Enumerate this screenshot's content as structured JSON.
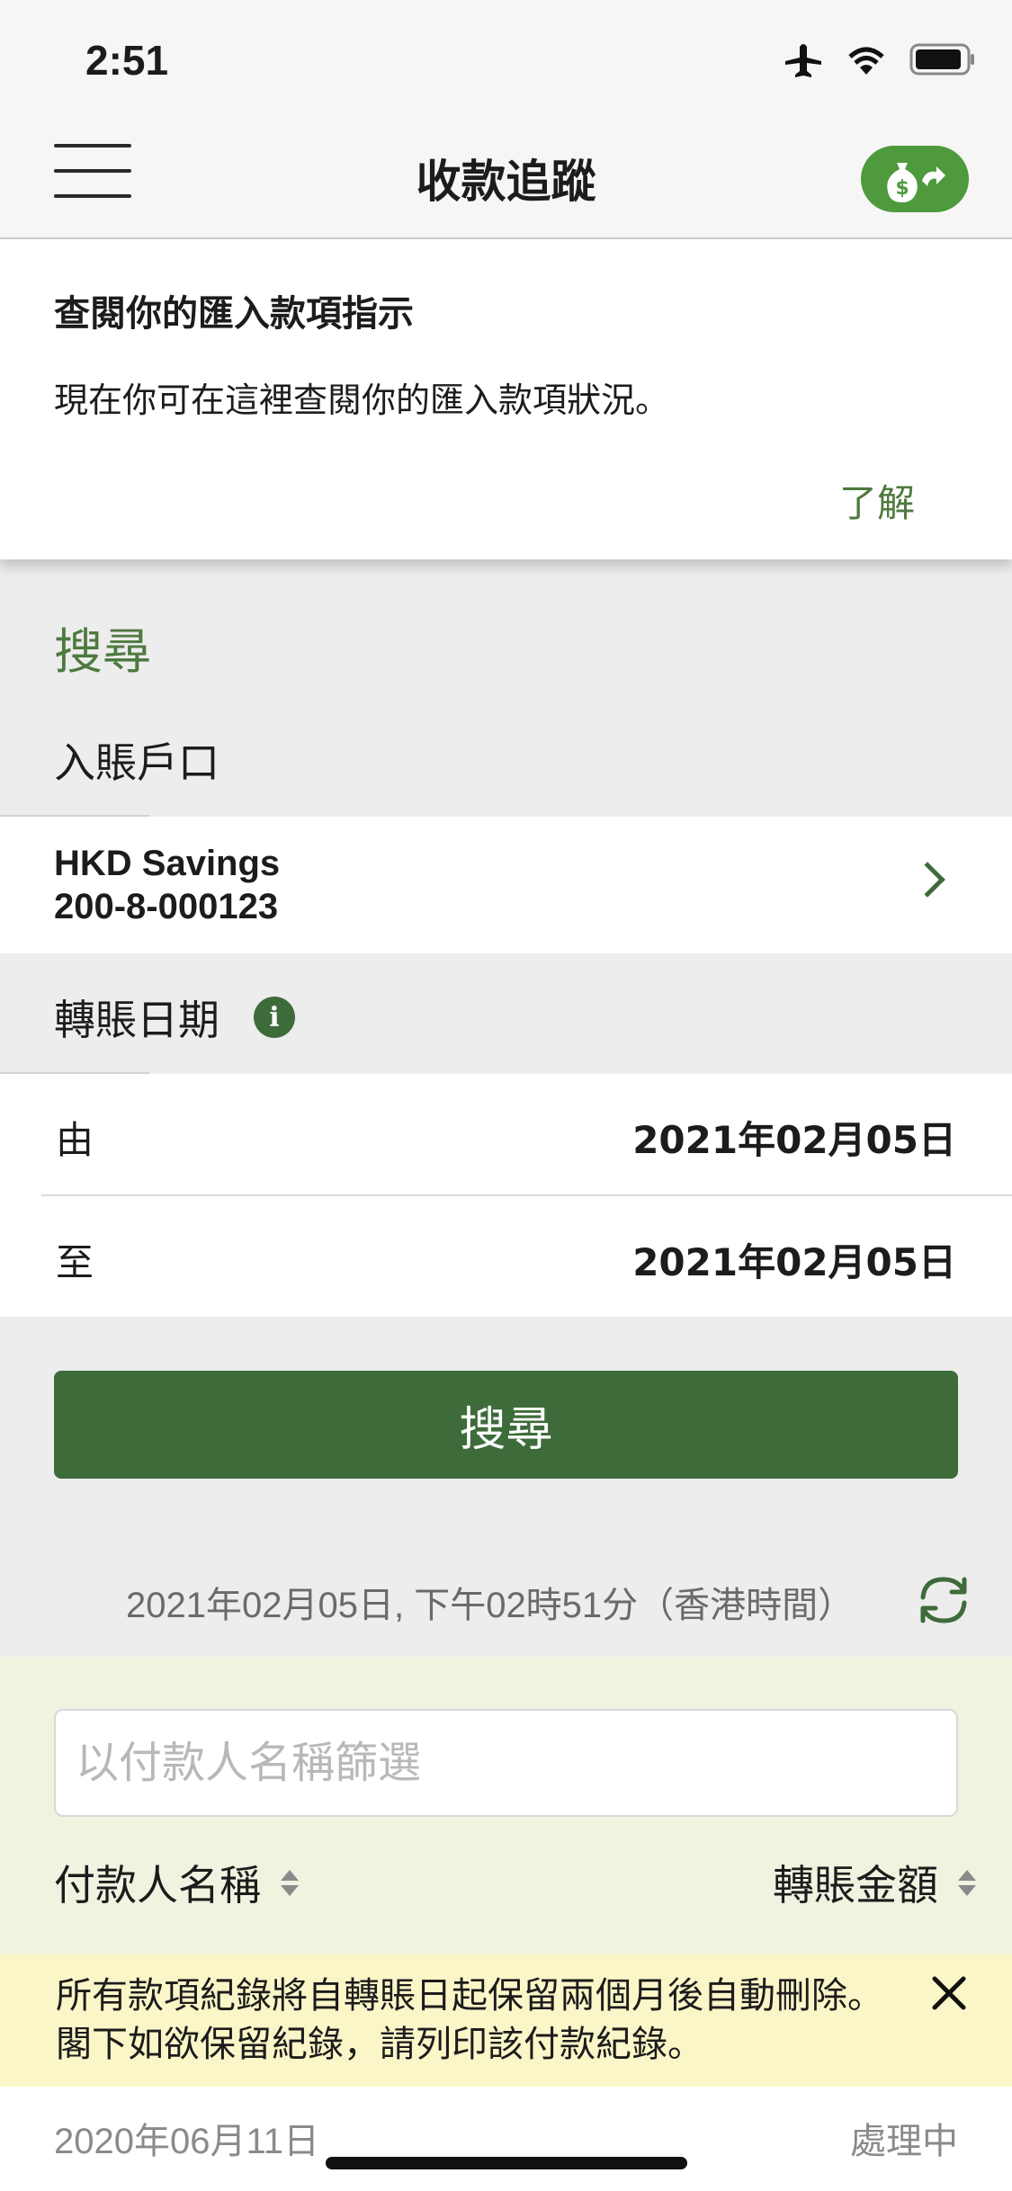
{
  "status_bar": {
    "time": "2:51"
  },
  "nav": {
    "title": "收款追蹤"
  },
  "tip": {
    "title": "查閱你的匯入款項指示",
    "body": "現在你可在這裡查閱你的匯入款項狀況。",
    "ok_label": "了解"
  },
  "search": {
    "heading": "搜尋",
    "account_label": "入賬戶口",
    "account": {
      "name": "HKD Savings",
      "number": "200-8-000123"
    },
    "date_label": "轉賬日期",
    "from_label": "由",
    "from_value": "2021年02月05日",
    "to_label": "至",
    "to_value": "2021年02月05日",
    "button_label": "搜尋"
  },
  "results": {
    "timestamp": "2021年02月05日, 下午02時51分（香港時間）",
    "filter_placeholder": "以付款人名稱篩選",
    "col_payer": "付款人名稱",
    "col_amount": "轉賬金額"
  },
  "notice": {
    "line1": "所有款項紀錄將自轉賬日起保留兩個月後自動刪除。",
    "line2": "閣下如欲保留紀錄，請列印該付款紀錄。"
  },
  "records": [
    {
      "date": "2020年06月11日",
      "status": "處理中"
    }
  ],
  "colors": {
    "brand_green": "#3e6b3a",
    "accent_green": "#4e9a3d",
    "notice_yellow": "#fbf6c8",
    "filter_bg": "#f0f3e0"
  }
}
